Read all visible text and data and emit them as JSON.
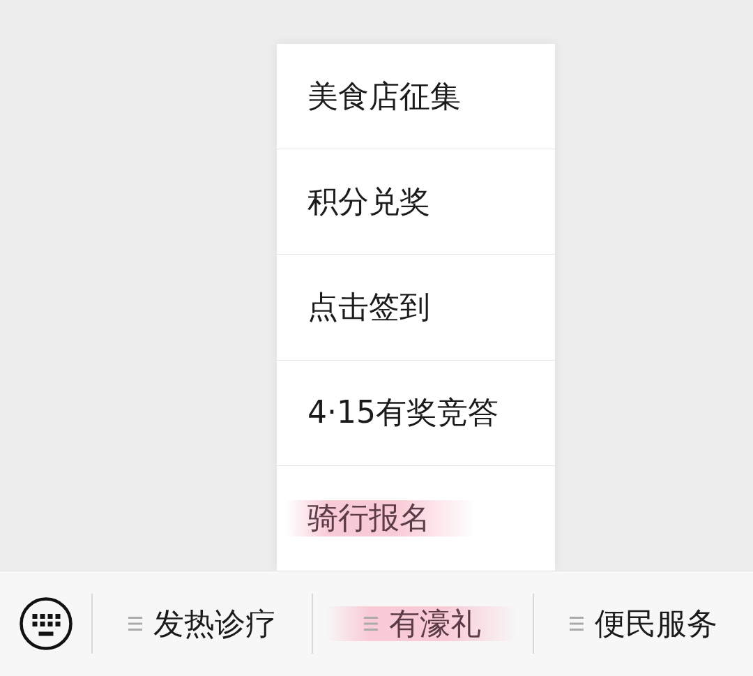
{
  "menu": {
    "items": [
      {
        "label": "美食店征集",
        "highlighted": false
      },
      {
        "label": "积分兑奖",
        "highlighted": false
      },
      {
        "label": "点击签到",
        "highlighted": false
      },
      {
        "label": "4·15有奖竞答",
        "highlighted": false
      },
      {
        "label": "骑行报名",
        "highlighted": true
      }
    ]
  },
  "bottom_bar": {
    "items": [
      {
        "label": "发热诊疗",
        "highlighted": false
      },
      {
        "label": "有濠礼",
        "highlighted": true
      },
      {
        "label": "便民服务",
        "highlighted": false
      }
    ]
  }
}
